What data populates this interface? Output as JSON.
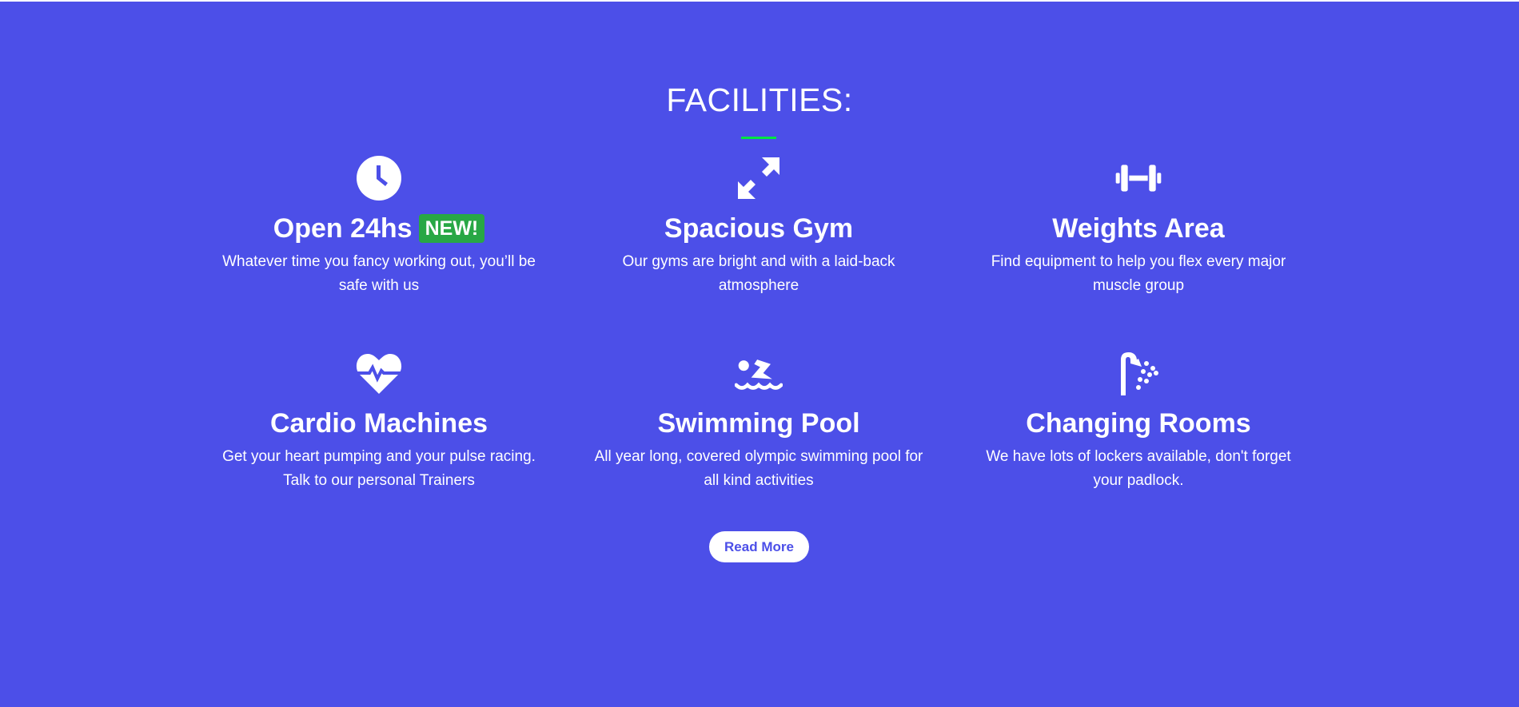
{
  "section": {
    "title": "FACILITIES:",
    "accent_color": "#00e640",
    "background": "#4c4fe8"
  },
  "facilities": [
    {
      "icon": "clock-icon",
      "title": "Open 24hs",
      "badge": "NEW!",
      "description": "Whatever time you fancy working out, you’ll be safe with us"
    },
    {
      "icon": "expand-arrows-icon",
      "title": "Spacious Gym",
      "description": "Our gyms are bright and with a laid-back atmosphere"
    },
    {
      "icon": "dumbbell-icon",
      "title": "Weights Area",
      "description": "Find equipment to help you flex every major muscle group"
    },
    {
      "icon": "heartbeat-icon",
      "title": "Cardio Machines",
      "description": "Get your heart pumping and your pulse racing. Talk to our personal Trainers"
    },
    {
      "icon": "swimmer-icon",
      "title": "Swimming Pool",
      "description": "All year long, covered olympic swimming pool for all kind activities"
    },
    {
      "icon": "shower-icon",
      "title": "Changing Rooms",
      "description": "We have lots of lockers available, don't forget your padlock."
    }
  ],
  "read_more_label": "Read More",
  "badge_color": "#28a745"
}
